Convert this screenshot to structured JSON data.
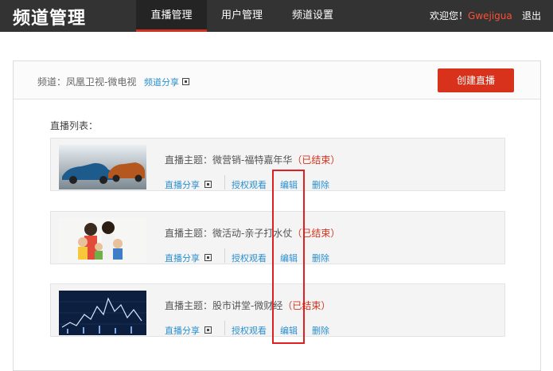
{
  "header": {
    "logo": "频道管理",
    "nav": [
      {
        "label": "直播管理",
        "active": true
      },
      {
        "label": "用户管理",
        "active": false
      },
      {
        "label": "频道设置",
        "active": false
      }
    ],
    "welcome_prefix": "欢迎您！",
    "username": "Gwejigua",
    "logout": "退出"
  },
  "channel": {
    "label": "频道：凤凰卫视-微电视",
    "share": "频道分享",
    "create_button": "创建直播"
  },
  "list_label": "直播列表：",
  "broadcasts": [
    {
      "title_prefix": "直播主题：",
      "title": "微营销-福特嘉年华",
      "status": "（已结束）",
      "thumb": "cars"
    },
    {
      "title_prefix": "直播主题：",
      "title": "微活动-亲子打水仗",
      "status": "（已结束）",
      "thumb": "family"
    },
    {
      "title_prefix": "直播主题：",
      "title": "股市讲堂-微财经",
      "status": "（已结束）",
      "thumb": "stock"
    }
  ],
  "actions": {
    "share": "直播分享",
    "auth": "授权观看",
    "edit": "编辑",
    "delete": "删除"
  },
  "colors": {
    "accent": "#d8321c",
    "link": "#2a8fcf",
    "topbar": "#333333"
  }
}
